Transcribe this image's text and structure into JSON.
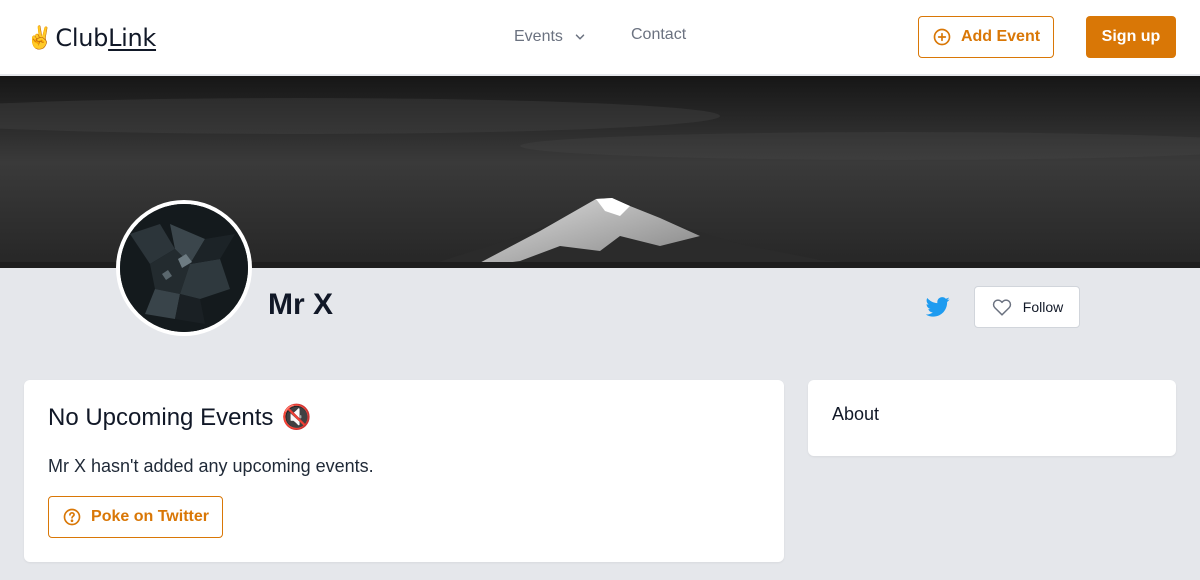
{
  "header": {
    "logo_emoji": "✌️",
    "logo_club": "Club",
    "logo_link": "Link",
    "nav_events_label": "Events",
    "nav_contact_label": "Contact",
    "add_event_label": "Add Event",
    "signup_label": "Sign up"
  },
  "profile": {
    "name": "Mr X",
    "follow_label": "Follow"
  },
  "events_card": {
    "title": "No Upcoming Events",
    "title_emoji": "🔇",
    "description": "Mr X hasn't added any upcoming events.",
    "poke_label": "Poke on Twitter"
  },
  "about_card": {
    "title": "About"
  },
  "icons": {
    "add": "plus-circle-icon",
    "chevron": "chevron-down-icon",
    "twitter": "twitter-icon",
    "follow": "heart-icon",
    "poke": "question-circle-icon"
  },
  "colors": {
    "accent": "#d97706",
    "twitter": "#1d9bf0",
    "page_background": "#e5e7eb"
  }
}
